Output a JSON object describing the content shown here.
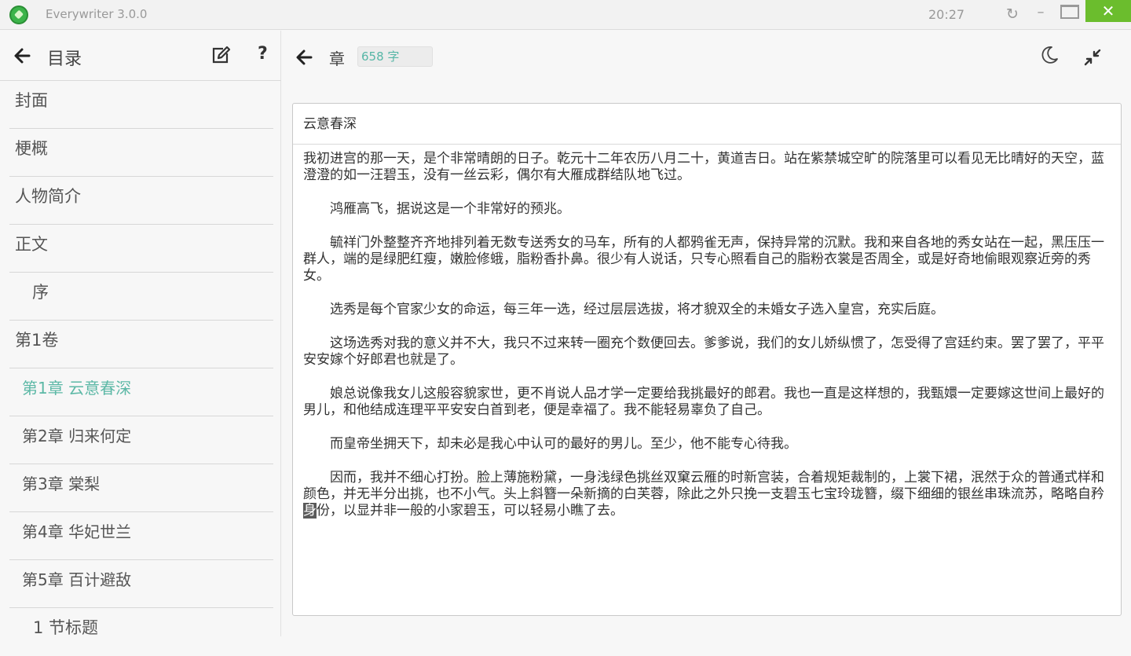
{
  "window": {
    "app_name": "Everywriter  3.0.0",
    "time": "20:27",
    "close_glyph": "✕",
    "refresh_glyph": "↻",
    "min_glyph": "–"
  },
  "sidebar": {
    "title": "目录",
    "help": "?",
    "items": [
      {
        "label": "封面"
      },
      {
        "label": "梗概"
      },
      {
        "label": "人物简介"
      },
      {
        "label": "正文"
      },
      {
        "label": "序"
      },
      {
        "label": "第1卷"
      },
      {
        "label": "第1章 云意春深"
      },
      {
        "label": "第2章 归来何定"
      },
      {
        "label": "第3章 棠梨"
      },
      {
        "label": "第4章 华妃世兰"
      },
      {
        "label": "第5章 百计避敌"
      },
      {
        "label": "1 节标题"
      }
    ]
  },
  "main": {
    "title": "章",
    "word_count": "658 字",
    "chapter_title": "云意春深",
    "paragraphs": [
      "我初进宫的那一天，是个非常晴朗的日子。乾元十二年农历八月二十，黄道吉日。站在紫禁城空旷的院落里可以看见无比晴好的天空，蓝澄澄的如一汪碧玉，没有一丝云彩，偶尔有大雁成群结队地飞过。",
      "鸿雁高飞，据说这是一个非常好的预兆。",
      "毓祥门外整整齐齐地排列着无数专送秀女的马车，所有的人都鸦雀无声，保持异常的沉默。我和来自各地的秀女站在一起，黑压压一群人，端的是绿肥红瘦，嫩脸修蛾，脂粉香扑鼻。很少有人说话，只专心照看自己的脂粉衣裳是否周全，或是好奇地偷眼观察近旁的秀女。",
      "选秀是每个官家少女的命运，每三年一选，经过层层选拔，将才貌双全的未婚女子选入皇宫，充实后庭。",
      "这场选秀对我的意义并不大，我只不过来转一圈充个数便回去。爹爹说，我们的女儿娇纵惯了，怎受得了宫廷约束。罢了罢了，平平安安嫁个好郎君也就是了。",
      "娘总说像我女儿这般容貌家世，更不肖说人品才学一定要给我挑最好的郎君。我也一直是这样想的，我甄嬛一定要嫁这世间上最好的男儿，和他结成连理平平安安白首到老，便是幸福了。我不能轻易辜负了自己。",
      "而皇帝坐拥天下，却未必是我心中认可的最好的男儿。至少，他不能专心待我。",
      "因而，我并不细心打扮。脸上薄施粉黛，一身浅绿色挑丝双窠云雁的时新宫装，合着规矩裁制的，上裳下裙，泯然于众的普通式样和颜色，并无半分出挑，也不小气。头上斜簪一朵新摘的白芙蓉，除此之外只挽一支碧玉七宝玲珑簪，缀下细细的银丝串珠流苏，略略自矜",
      "身",
      "份，以显并非一般的小家碧玉，可以轻易小瞧了去。"
    ]
  },
  "colors": {
    "accent": "#5cb8a6",
    "close_bg": "#6bbd2d"
  }
}
